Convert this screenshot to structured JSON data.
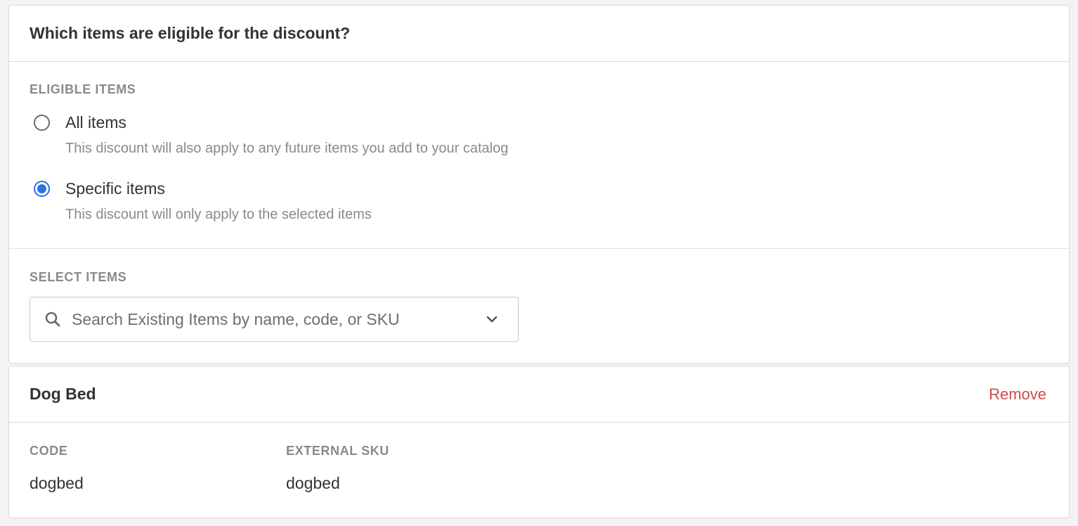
{
  "eligibility": {
    "title": "Which items are eligible for the discount?",
    "eligible_label": "ELIGIBLE ITEMS",
    "options": [
      {
        "label": "All items",
        "description": "This discount will also apply to any future items you add to your catalog",
        "selected": false
      },
      {
        "label": "Specific items",
        "description": "This discount will only apply to the selected items",
        "selected": true
      }
    ],
    "select_label": "SELECT ITEMS",
    "search": {
      "placeholder": "Search Existing Items by name, code, or SKU",
      "icon": "search-icon",
      "dropdown_icon": "chevron-down-icon"
    },
    "accent_color": "#2a72e5"
  },
  "selected_item": {
    "name": "Dog Bed",
    "remove_label": "Remove",
    "remove_color": "#cf4a4a",
    "fields": [
      {
        "label": "CODE",
        "value": "dogbed"
      },
      {
        "label": "EXTERNAL SKU",
        "value": "dogbed"
      }
    ]
  }
}
